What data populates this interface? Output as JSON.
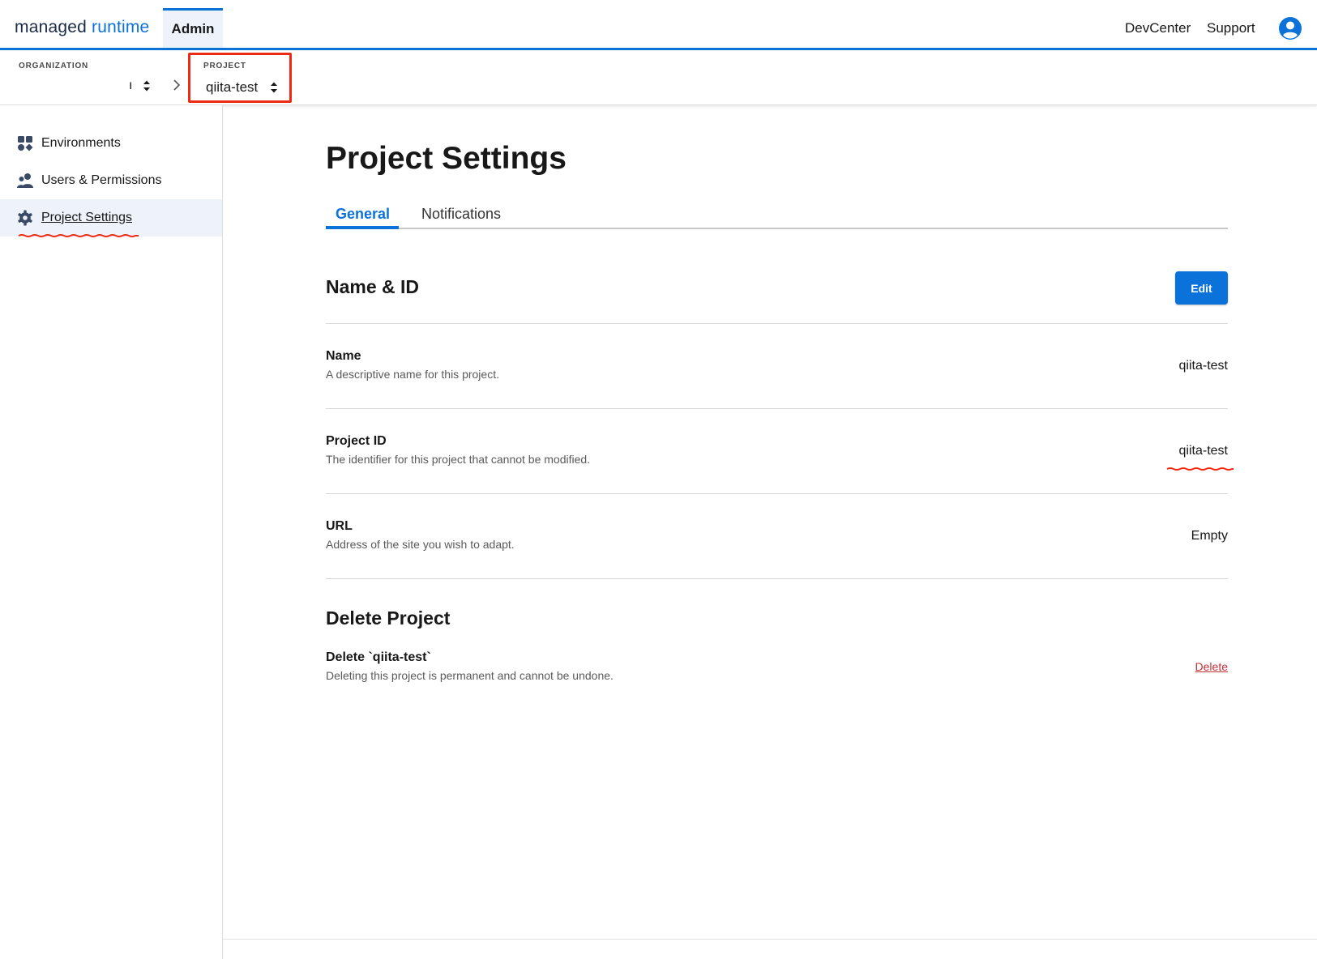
{
  "header": {
    "logo_part1": "managed",
    "logo_part2": " runtime",
    "active_tab": "Admin",
    "links": {
      "devcenter": "DevCenter",
      "support": "Support"
    },
    "icons": {
      "avatar": "user-circle-icon"
    }
  },
  "selectors": {
    "organization": {
      "label": "ORGANIZATION",
      "value": "ı"
    },
    "project": {
      "label": "PROJECT",
      "value": "qiita-test"
    }
  },
  "sidebar": {
    "items": [
      {
        "label": "Environments",
        "icon": "environments-grid-icon",
        "active": false
      },
      {
        "label": "Users & Permissions",
        "icon": "users-icon",
        "active": false
      },
      {
        "label": "Project Settings",
        "icon": "gear-icon",
        "active": true
      }
    ]
  },
  "main": {
    "title": "Project Settings",
    "tabs": [
      {
        "label": "General",
        "active": true
      },
      {
        "label": "Notifications",
        "active": false
      }
    ],
    "name_id_section": {
      "title": "Name & ID",
      "edit_label": "Edit",
      "fields": [
        {
          "name": "Name",
          "description": "A descriptive name for this project.",
          "value": "qiita-test"
        },
        {
          "name": "Project ID",
          "description": "The identifier for this project that cannot be modified.",
          "value": "qiita-test"
        },
        {
          "name": "URL",
          "description": "Address of the site you wish to adapt.",
          "value": "Empty"
        }
      ]
    },
    "delete_section": {
      "title": "Delete Project",
      "item_name": "Delete `qiita-test`",
      "item_description": "Deleting this project is permanent and cannot be undone.",
      "action_label": "Delete"
    }
  },
  "colors": {
    "brand_blue": "#0b72d9",
    "annotation_red": "#ee2a14",
    "danger_red": "#c4323a",
    "active_bg": "#eef3fb"
  }
}
